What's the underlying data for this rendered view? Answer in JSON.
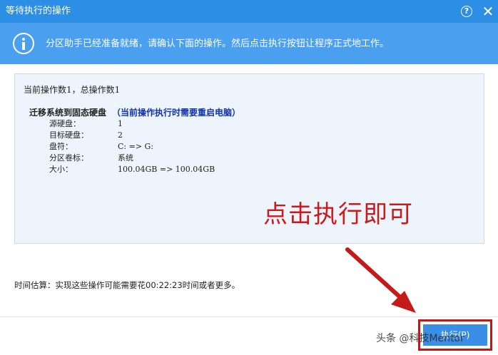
{
  "window": {
    "title": "等待执行的操作",
    "help_label": "?",
    "close_label": "✕"
  },
  "infobar": {
    "icon": "info-icon",
    "text": "分区助手已经准备就绪，请确认下面的操作。然后点击执行按钮让程序正式地工作。"
  },
  "operations": {
    "summary": "当前操作数1，总操作数1",
    "items": [
      {
        "title": "迁移系统到固态硬盘",
        "note": "（当前操作执行时需要重启电脑）",
        "details": [
          {
            "label": "源硬盘：",
            "value": "1"
          },
          {
            "label": "目标硬盘：",
            "value": "2"
          },
          {
            "label": "盘符：",
            "value": "C: => G:"
          },
          {
            "label": "分区卷标：",
            "value": "系统"
          },
          {
            "label": "大小：",
            "value": "100.04GB => 100.04GB"
          }
        ]
      }
    ]
  },
  "annotation": {
    "hint_text": "点击执行即可",
    "color": "#cc1a1a"
  },
  "estimate": "时间估算：实现这些操作可能需要花00:22:23时间或者更多。",
  "footer": {
    "execute_label": "执行(P)"
  },
  "watermark": "头条 @科技Mentor",
  "colors": {
    "titlebar": "#2d8ee6",
    "infobar": "#4a9fef",
    "panel": "#eef4fb",
    "note": "#1133aa"
  }
}
